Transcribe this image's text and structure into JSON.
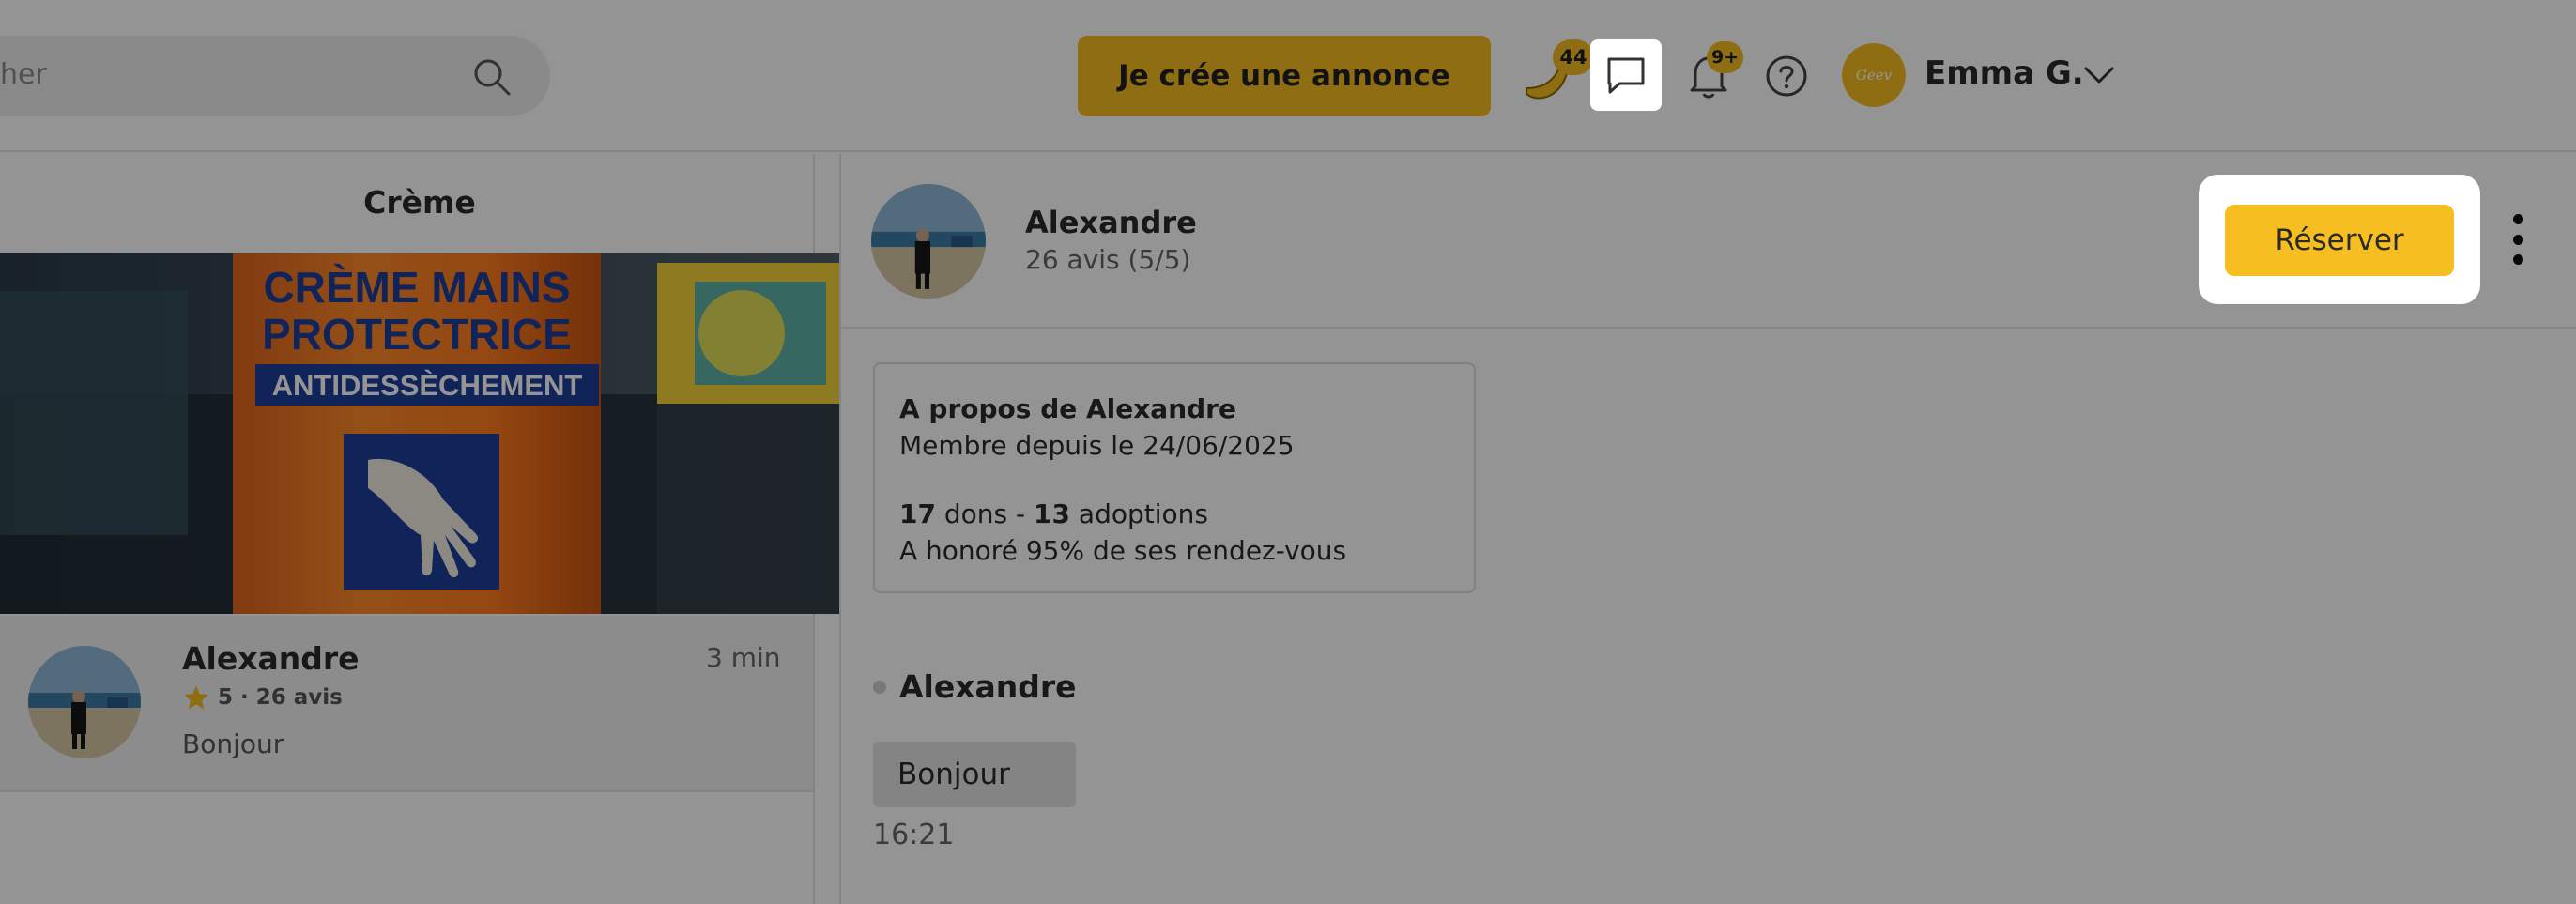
{
  "header": {
    "search_placeholder": "her",
    "cta_label": "Je crée une annonce",
    "banana_count": "44",
    "notification_count": "9+",
    "user_avatar_text": "Geev",
    "user_name": "Emma G."
  },
  "sidebar": {
    "title": "Crème",
    "conversation": {
      "name": "Alexandre",
      "time": "3 min",
      "rating": "5 · 26 avis",
      "preview": "Bonjour"
    }
  },
  "chat": {
    "name": "Alexandre",
    "reviews": "26 avis (5/5)",
    "reserve_label": "Réserver",
    "about": {
      "title": "A propos de Alexandre",
      "member_since": "Membre depuis le 24/06/2025",
      "dons_count": "17",
      "dons_label": "dons -",
      "adoptions_count": "13",
      "adoptions_label": "adoptions",
      "honored": "A honoré 95% de ses rendez-vous"
    },
    "message": {
      "sender": "Alexandre",
      "text": "Bonjour",
      "time": "16:21"
    }
  },
  "product_photo": {
    "line1": "CRÈME MAINS",
    "line2": "PROTECTRICE",
    "line3": "ANTIDESSÈCHEMENT"
  },
  "colors": {
    "accent": "#f7be21",
    "overlay": "rgba(0,0,0,0.42)"
  }
}
